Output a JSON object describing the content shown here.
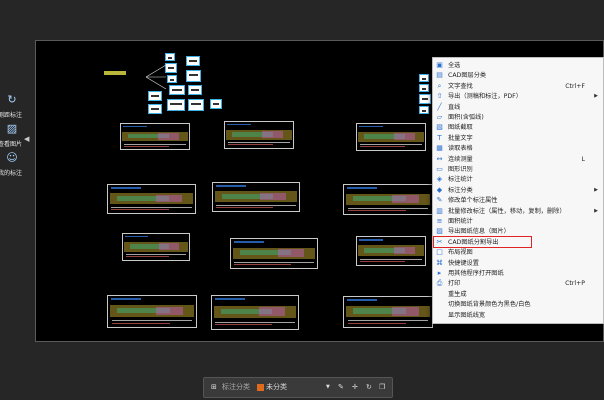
{
  "left_tools": [
    {
      "icon": "refresh-icon",
      "label": "测距标注"
    },
    {
      "icon": "image-icon",
      "label": "查看图片"
    },
    {
      "icon": "user-icon",
      "label": "我的标注"
    }
  ],
  "context_menu": {
    "items": [
      {
        "icon": "select-all-icon",
        "label": "全选",
        "shortcut": "",
        "submenu": false
      },
      {
        "icon": "layers-icon",
        "label": "CAD图层分类",
        "shortcut": "",
        "submenu": false
      },
      {
        "icon": "text-search-icon",
        "label": "文字查找",
        "shortcut": "Ctrl+F",
        "submenu": false
      },
      {
        "icon": "export-icon",
        "label": "导出（测稿和标注，PDF）",
        "shortcut": "",
        "submenu": true
      },
      {
        "icon": "line-icon",
        "label": "直线",
        "shortcut": "",
        "submenu": false
      },
      {
        "icon": "area-icon",
        "label": "面积(含弧线)",
        "shortcut": "",
        "submenu": false
      },
      {
        "icon": "page-mark-icon",
        "label": "图纸截取",
        "shortcut": "",
        "submenu": false
      },
      {
        "icon": "text-icon",
        "label": "批量文字",
        "shortcut": "",
        "submenu": false
      },
      {
        "icon": "table-icon",
        "label": "读取表格",
        "shortcut": "",
        "submenu": false
      },
      {
        "icon": "measure-icon",
        "label": "连续测量",
        "shortcut": "L",
        "submenu": false
      },
      {
        "icon": "chart-icon",
        "label": "图形识别",
        "shortcut": "",
        "submenu": false
      },
      {
        "icon": "mark-icon",
        "label": "标注统计",
        "shortcut": "",
        "submenu": false
      },
      {
        "icon": "tag-icon",
        "label": "标注分类",
        "shortcut": "",
        "submenu": true
      },
      {
        "icon": "edit-icon",
        "label": "修改单个标注属性",
        "shortcut": "",
        "submenu": false
      },
      {
        "icon": "batch-icon",
        "label": "批量修改标注（属性，移动，复制，删除）",
        "shortcut": "",
        "submenu": true
      },
      {
        "icon": "stats-icon",
        "label": "面积统计",
        "shortcut": "",
        "submenu": false
      },
      {
        "icon": "image-icon",
        "label": "导出图纸信息（图片）",
        "shortcut": "",
        "submenu": false
      },
      {
        "icon": "split-icon",
        "label": "CAD图纸分割导出",
        "shortcut": "",
        "submenu": false
      },
      {
        "icon": "layout-icon",
        "label": "布局视图",
        "shortcut": "",
        "submenu": false
      },
      {
        "icon": "quick-icon",
        "label": "快捷键设置",
        "shortcut": "",
        "submenu": false
      },
      {
        "icon": "open-icon",
        "label": "用其他程序打开图纸",
        "shortcut": "",
        "submenu": false
      },
      {
        "icon": "print-icon",
        "label": "打印",
        "shortcut": "Ctrl+P",
        "submenu": false
      },
      {
        "icon": "",
        "label": "重生成",
        "shortcut": "",
        "submenu": false
      },
      {
        "icon": "",
        "label": "切换图纸背景颜色为黑色/白色",
        "shortcut": "",
        "submenu": false
      },
      {
        "icon": "",
        "label": "显示图纸线宽",
        "shortcut": "",
        "submenu": false
      }
    ],
    "highlighted_index": 17
  },
  "bottom_bar": {
    "grid_label": "标注分类",
    "category_label": "未分类",
    "category_color": "#e06a1b"
  },
  "colors": {
    "highlight_box": "#e02424",
    "canvas_bg": "#000000",
    "app_bg": "#262626"
  }
}
